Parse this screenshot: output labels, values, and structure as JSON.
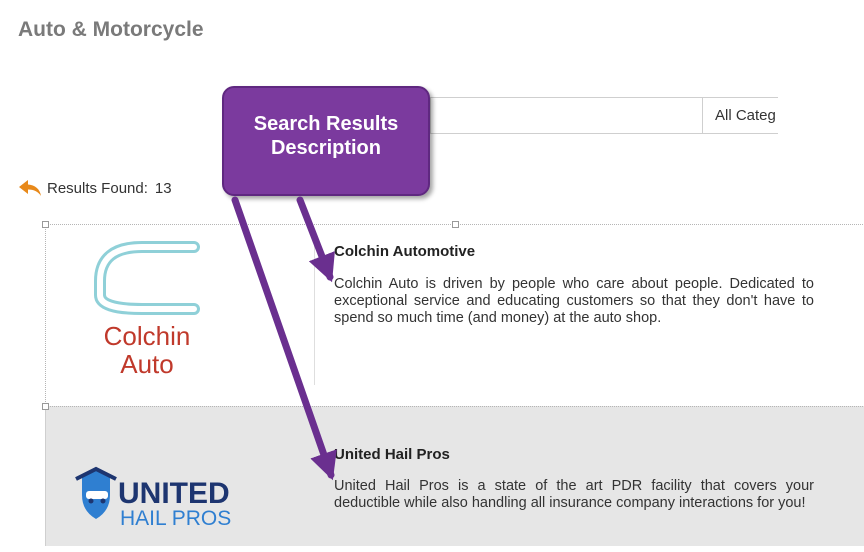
{
  "page": {
    "title": "Auto & Motorcycle"
  },
  "search": {
    "category_label": "All Categ"
  },
  "results": {
    "label": "Results Found:",
    "count": "13"
  },
  "callout": {
    "line1": "Search Results",
    "line2": "Description"
  },
  "listings": [
    {
      "name": "Colchin Automotive",
      "description": "Colchin Auto is driven by people who care about people. Dedicated to exceptional service and educating customers so that they don't have to spend so much time (and money) at the auto shop.",
      "logo_text_1": "Colchin",
      "logo_text_2": "Auto"
    },
    {
      "name": "United Hail Pros",
      "description": "United Hail Pros is a state of the art PDR facility that covers your deductible while also handling all insurance company interactions for you!",
      "logo_text_1": "UNITED",
      "logo_text_2": "HAIL PROS"
    }
  ],
  "colors": {
    "callout_purple": "#7b3a9e",
    "back_arrow_orange": "#e8891a",
    "colchin_red": "#c0392b",
    "colchin_teal": "#8fd0d8",
    "united_navy": "#1d3570",
    "united_blue": "#2f7fd1"
  },
  "icons": {
    "back": "reply-arrow-icon"
  }
}
